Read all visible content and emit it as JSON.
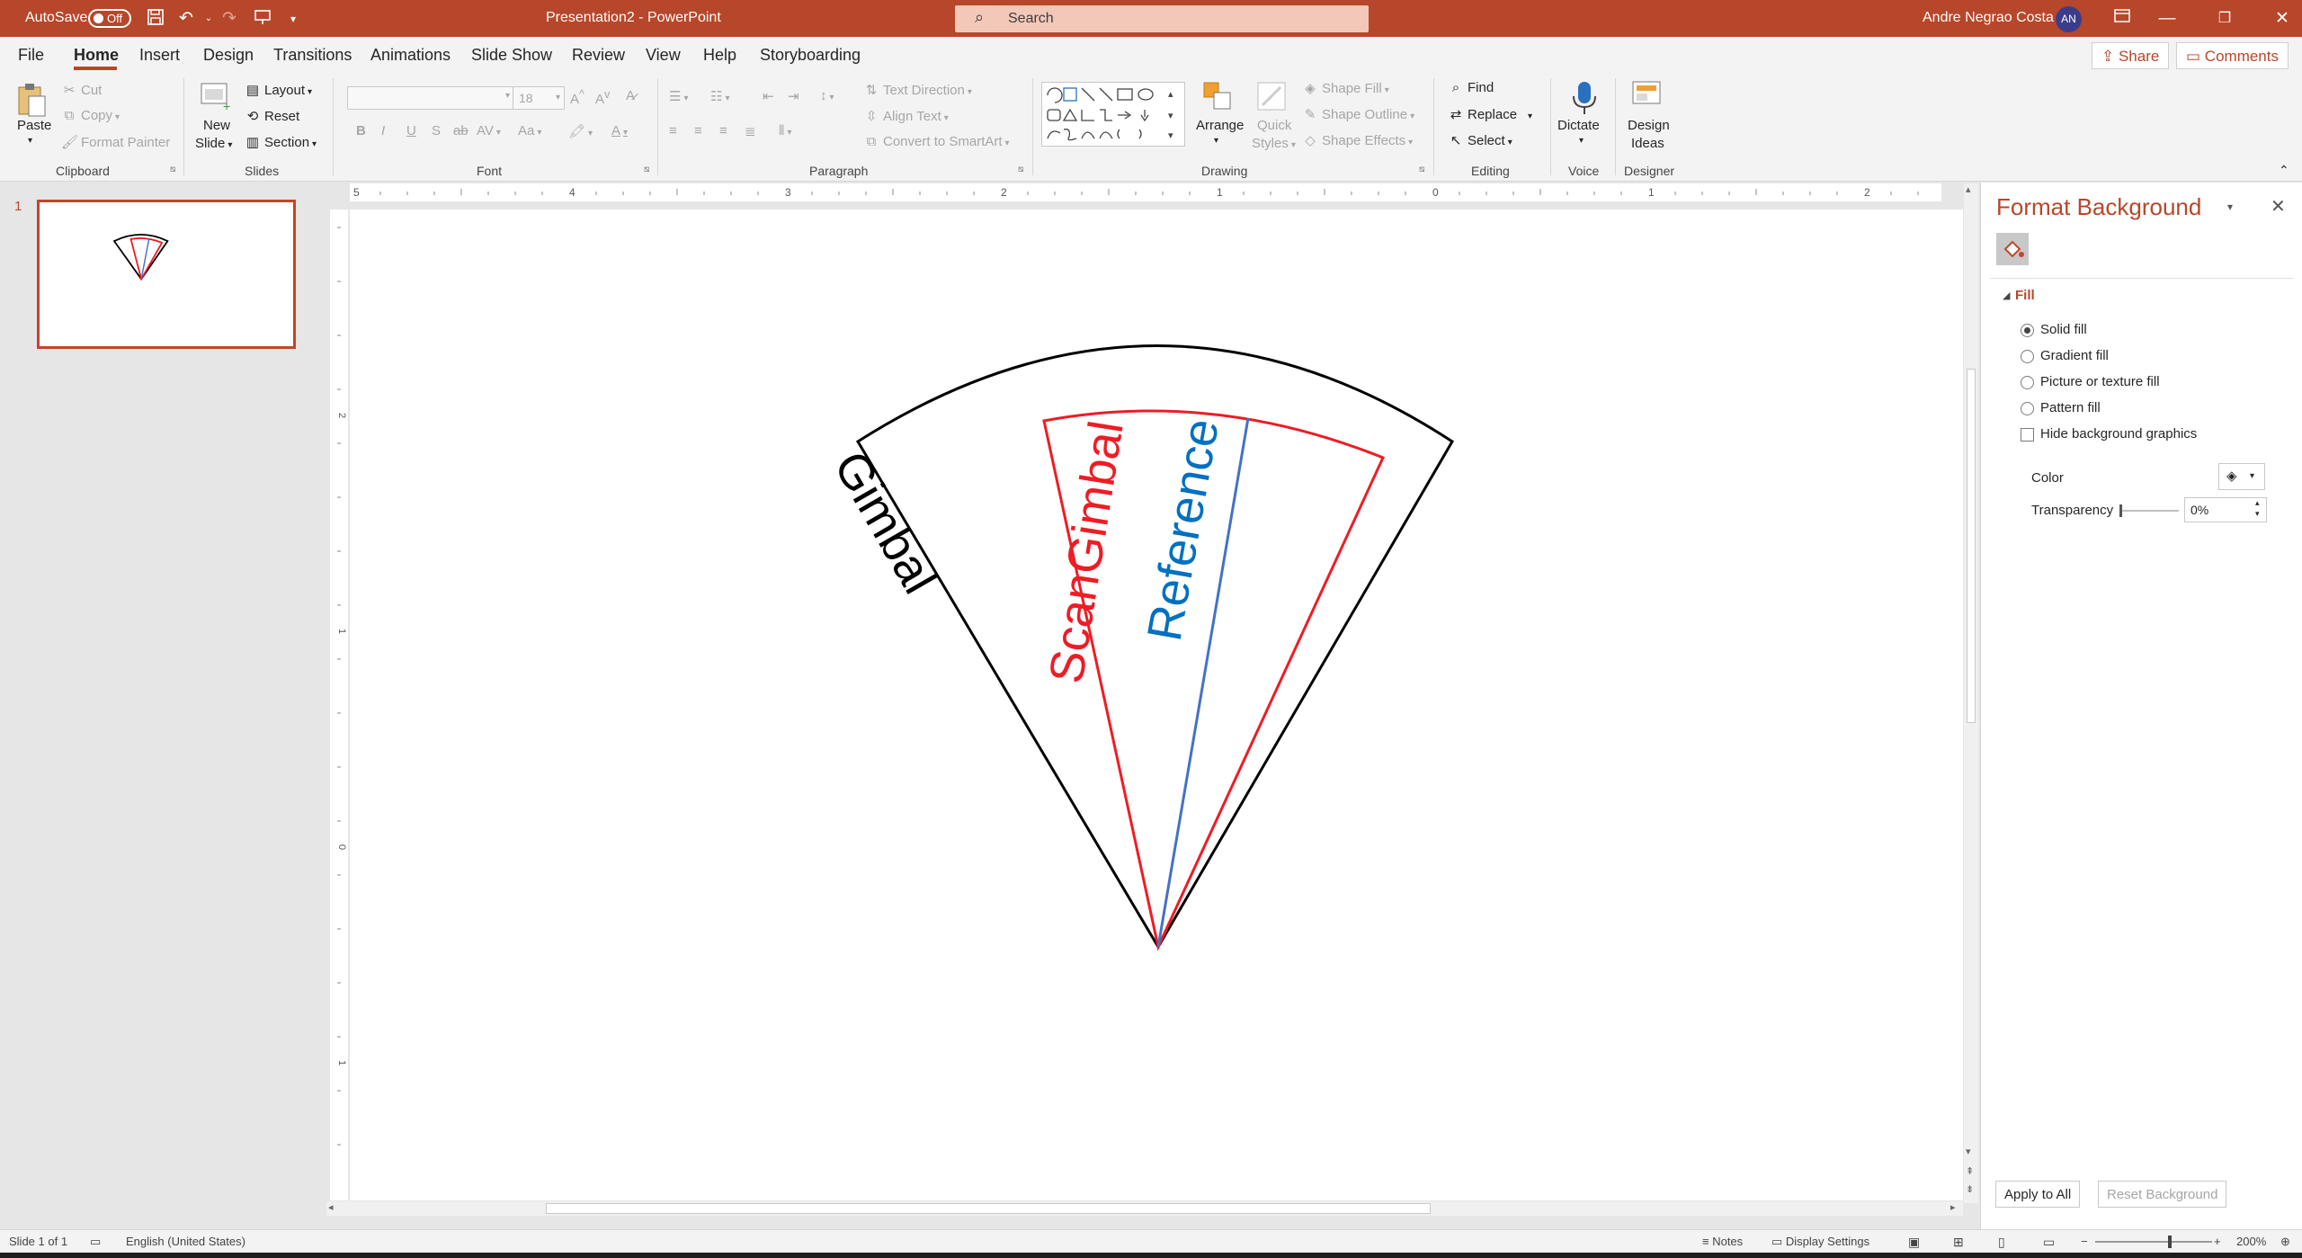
{
  "titlebar": {
    "autosave_label": "AutoSave",
    "autosave_state": "Off",
    "doc_title": "Presentation2  -  PowerPoint",
    "search_placeholder": "Search",
    "user_name": "Andre Negrao Costa",
    "user_initials": "AN"
  },
  "tabs": [
    "File",
    "Home",
    "Insert",
    "Design",
    "Transitions",
    "Animations",
    "Slide Show",
    "Review",
    "View",
    "Help",
    "Storyboarding"
  ],
  "share_label": "Share",
  "comments_label": "Comments",
  "ribbon": {
    "clipboard": {
      "paste": "Paste",
      "cut": "Cut",
      "copy": "Copy",
      "format_painter": "Format Painter",
      "label": "Clipboard"
    },
    "slides": {
      "new_slide_1": "New",
      "new_slide_2": "Slide",
      "layout": "Layout",
      "reset": "Reset",
      "section": "Section",
      "label": "Slides"
    },
    "font": {
      "size": "18",
      "label": "Font"
    },
    "paragraph": {
      "text_direction": "Text Direction",
      "align_text": "Align Text",
      "convert_smartart": "Convert to SmartArt",
      "label": "Paragraph"
    },
    "drawing": {
      "arrange": "Arrange",
      "quick_styles_1": "Quick",
      "quick_styles_2": "Styles",
      "shape_fill": "Shape Fill",
      "shape_outline": "Shape Outline",
      "shape_effects": "Shape Effects",
      "label": "Drawing"
    },
    "editing": {
      "find": "Find",
      "replace": "Replace",
      "select": "Select",
      "label": "Editing"
    },
    "voice": {
      "dictate": "Dictate",
      "label": "Voice"
    },
    "designer": {
      "design_ideas_1": "Design",
      "design_ideas_2": "Ideas",
      "label": "Designer"
    }
  },
  "thumbnails": {
    "slide_number": "1"
  },
  "ruler": {
    "h_labels": [
      "5",
      "4",
      "3",
      "2",
      "1",
      "0",
      "1",
      "2"
    ],
    "v_labels": [
      "2",
      "1",
      "0",
      "1"
    ]
  },
  "slide": {
    "labels": {
      "gimbal": "Gimbal",
      "scangimbal": "ScanGimbal",
      "reference": "Reference"
    },
    "colors": {
      "gimbal": "#000000",
      "scangimbal": "#ee1c25",
      "reference": "#0070c0",
      "reference_line": "#4472c4"
    }
  },
  "format_pane": {
    "title": "Format Background",
    "section": "Fill",
    "options": [
      "Solid fill",
      "Gradient fill",
      "Picture or texture fill",
      "Pattern fill"
    ],
    "selected_option": "Solid fill",
    "hide_bg": "Hide background graphics",
    "color_label": "Color",
    "transparency_label": "Transparency",
    "transparency_value": "0%",
    "apply_all": "Apply to All",
    "reset_bg": "Reset Background"
  },
  "status": {
    "slide_info": "Slide 1 of 1",
    "language": "English (United States)",
    "notes": "Notes",
    "display_settings": "Display Settings",
    "zoom": "200%"
  },
  "accent_color": "#b7472a"
}
